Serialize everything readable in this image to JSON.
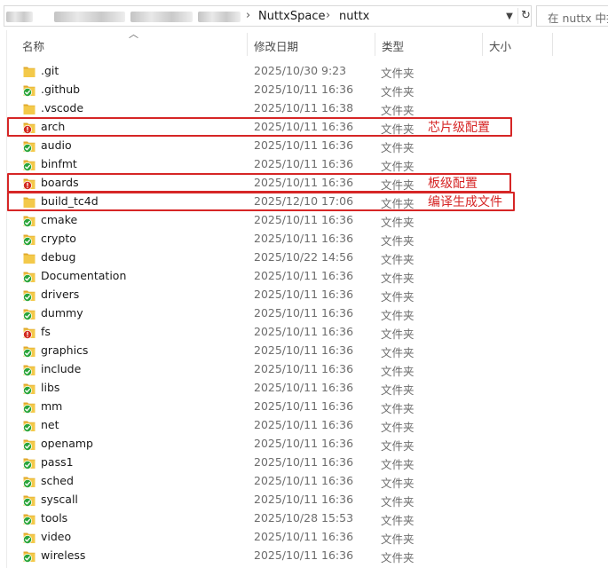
{
  "address": {
    "path": [
      "NuttxSpace",
      "nuttx"
    ],
    "search_placeholder": "在 nuttx 中搜索"
  },
  "columns": {
    "name": "名称",
    "date": "修改日期",
    "type": "类型",
    "size": "大小"
  },
  "files": [
    {
      "name": ".git",
      "date": "2025/10/30 9:23",
      "type": "文件夹",
      "status": "none"
    },
    {
      "name": ".github",
      "date": "2025/10/11 16:36",
      "type": "文件夹",
      "status": "ok"
    },
    {
      "name": ".vscode",
      "date": "2025/10/11 16:38",
      "type": "文件夹",
      "status": "none"
    },
    {
      "name": "arch",
      "date": "2025/10/11 16:36",
      "type": "文件夹",
      "status": "modified"
    },
    {
      "name": "audio",
      "date": "2025/10/11 16:36",
      "type": "文件夹",
      "status": "ok"
    },
    {
      "name": "binfmt",
      "date": "2025/10/11 16:36",
      "type": "文件夹",
      "status": "ok"
    },
    {
      "name": "boards",
      "date": "2025/10/11 16:36",
      "type": "文件夹",
      "status": "modified"
    },
    {
      "name": "build_tc4d",
      "date": "2025/12/10 17:06",
      "type": "文件夹",
      "status": "none"
    },
    {
      "name": "cmake",
      "date": "2025/10/11 16:36",
      "type": "文件夹",
      "status": "ok"
    },
    {
      "name": "crypto",
      "date": "2025/10/11 16:36",
      "type": "文件夹",
      "status": "ok"
    },
    {
      "name": "debug",
      "date": "2025/10/22 14:56",
      "type": "文件夹",
      "status": "none"
    },
    {
      "name": "Documentation",
      "date": "2025/10/11 16:36",
      "type": "文件夹",
      "status": "ok"
    },
    {
      "name": "drivers",
      "date": "2025/10/11 16:36",
      "type": "文件夹",
      "status": "ok"
    },
    {
      "name": "dummy",
      "date": "2025/10/11 16:36",
      "type": "文件夹",
      "status": "ok"
    },
    {
      "name": "fs",
      "date": "2025/10/11 16:36",
      "type": "文件夹",
      "status": "modified"
    },
    {
      "name": "graphics",
      "date": "2025/10/11 16:36",
      "type": "文件夹",
      "status": "ok"
    },
    {
      "name": "include",
      "date": "2025/10/11 16:36",
      "type": "文件夹",
      "status": "ok"
    },
    {
      "name": "libs",
      "date": "2025/10/11 16:36",
      "type": "文件夹",
      "status": "ok"
    },
    {
      "name": "mm",
      "date": "2025/10/11 16:36",
      "type": "文件夹",
      "status": "ok"
    },
    {
      "name": "net",
      "date": "2025/10/11 16:36",
      "type": "文件夹",
      "status": "ok"
    },
    {
      "name": "openamp",
      "date": "2025/10/11 16:36",
      "type": "文件夹",
      "status": "ok"
    },
    {
      "name": "pass1",
      "date": "2025/10/11 16:36",
      "type": "文件夹",
      "status": "ok"
    },
    {
      "name": "sched",
      "date": "2025/10/11 16:36",
      "type": "文件夹",
      "status": "ok"
    },
    {
      "name": "syscall",
      "date": "2025/10/11 16:36",
      "type": "文件夹",
      "status": "ok"
    },
    {
      "name": "tools",
      "date": "2025/10/28 15:53",
      "type": "文件夹",
      "status": "ok"
    },
    {
      "name": "video",
      "date": "2025/10/11 16:36",
      "type": "文件夹",
      "status": "ok"
    },
    {
      "name": "wireless",
      "date": "2025/10/11 16:36",
      "type": "文件夹",
      "status": "ok"
    }
  ],
  "annotations": [
    {
      "text": "芯片级配置",
      "target": "arch"
    },
    {
      "text": "板级配置",
      "target": "boards"
    },
    {
      "text": "编译生成文件",
      "target": "build_tc4d"
    }
  ],
  "colors": {
    "folder": "#f3c94a",
    "folder_dark": "#e0a92c",
    "ok": "#2aa53a",
    "modified": "#d22a1f",
    "annotation": "#d62626"
  }
}
